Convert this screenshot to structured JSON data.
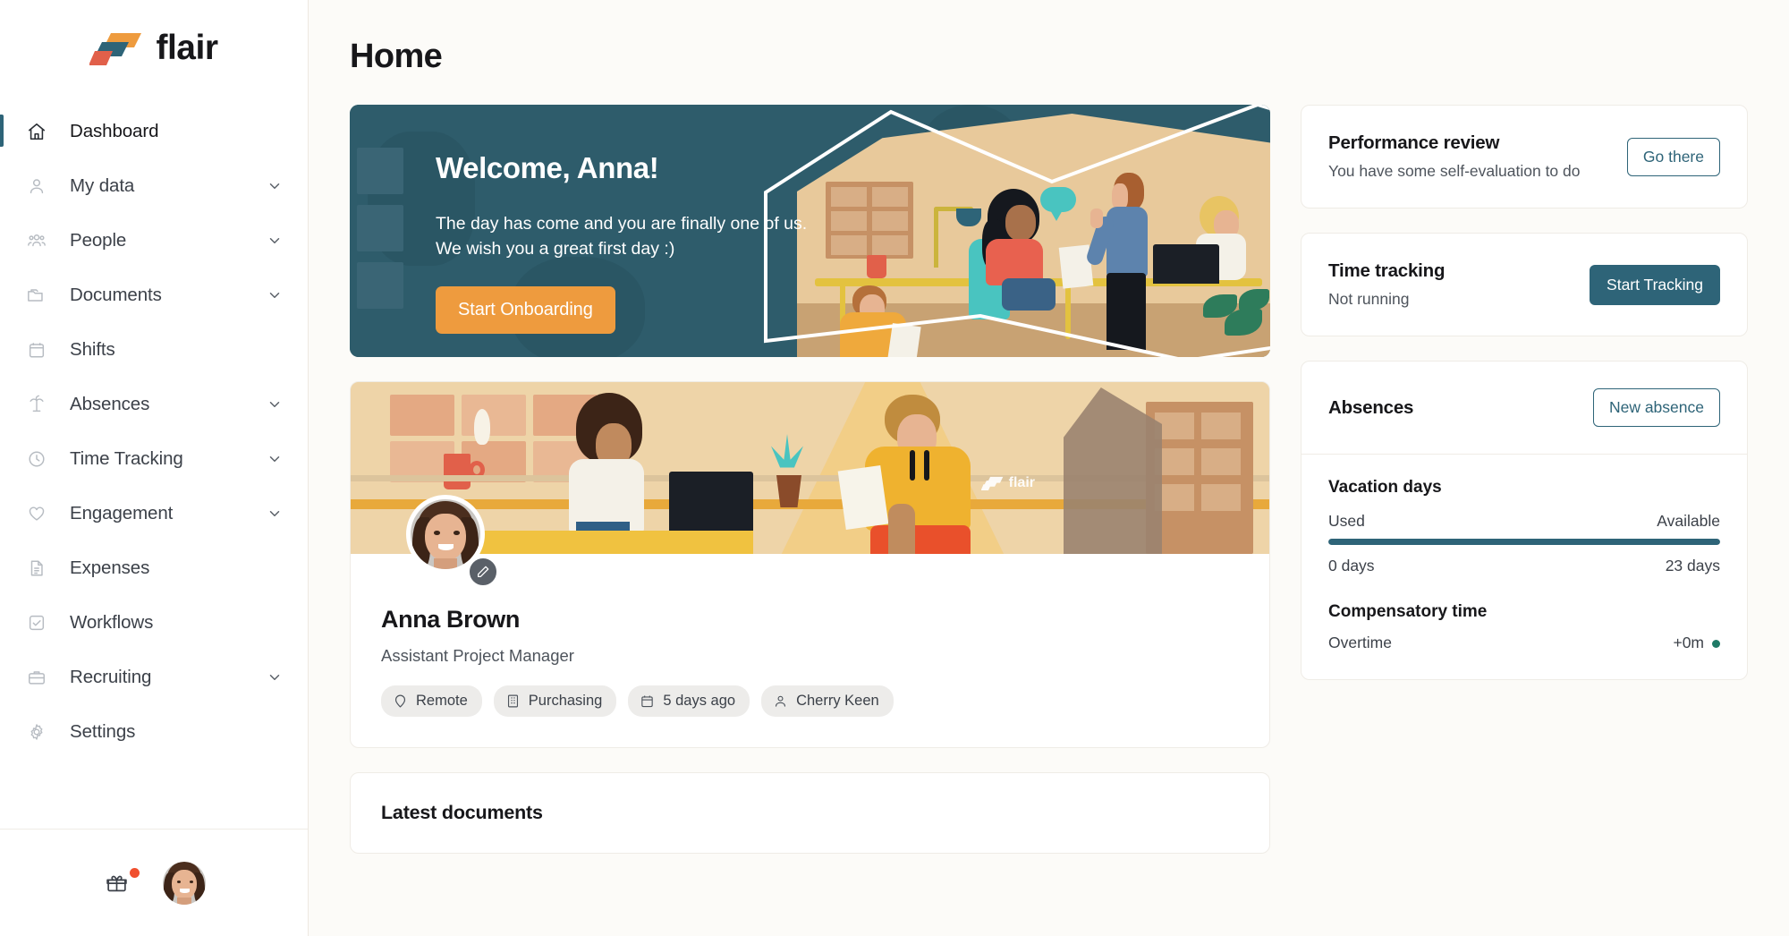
{
  "brand": {
    "name": "flair",
    "colors": {
      "orange": "#EE9B3E",
      "teal": "#2E6478",
      "coral": "#E1604A",
      "dark": "#17171A"
    }
  },
  "sidebar": {
    "items": [
      {
        "label": "Dashboard",
        "icon": "home-icon",
        "active": true,
        "expandable": false
      },
      {
        "label": "My data",
        "icon": "user-icon",
        "active": false,
        "expandable": true
      },
      {
        "label": "People",
        "icon": "people-icon",
        "active": false,
        "expandable": true
      },
      {
        "label": "Documents",
        "icon": "folder-icon",
        "active": false,
        "expandable": true
      },
      {
        "label": "Shifts",
        "icon": "calendar-icon",
        "active": false,
        "expandable": false
      },
      {
        "label": "Absences",
        "icon": "palm-tree-icon",
        "active": false,
        "expandable": true
      },
      {
        "label": "Time Tracking",
        "icon": "clock-icon",
        "active": false,
        "expandable": true
      },
      {
        "label": "Engagement",
        "icon": "heart-icon",
        "active": false,
        "expandable": true
      },
      {
        "label": "Expenses",
        "icon": "document-icon",
        "active": false,
        "expandable": false
      },
      {
        "label": "Workflows",
        "icon": "checkbox-icon",
        "active": false,
        "expandable": false
      },
      {
        "label": "Recruiting",
        "icon": "briefcase-icon",
        "active": false,
        "expandable": true
      },
      {
        "label": "Settings",
        "icon": "gear-icon",
        "active": false,
        "expandable": false
      }
    ],
    "footer": {
      "gift_icon": "gift-icon",
      "has_notification": true,
      "avatar_icon": "user-avatar"
    }
  },
  "header": {
    "title": "Home"
  },
  "welcome": {
    "title": "Welcome, Anna!",
    "line1": "The day has come and you are finally one of us.",
    "line2": "We wish you a great first day :)",
    "cta": "Start Onboarding"
  },
  "profile": {
    "name": "Anna Brown",
    "role": "Assistant Project Manager",
    "edit_icon": "pencil-icon",
    "tags": [
      {
        "label": "Remote",
        "icon": "location-pin-icon"
      },
      {
        "label": "Purchasing",
        "icon": "building-icon"
      },
      {
        "label": "5 days ago",
        "icon": "calendar-icon"
      },
      {
        "label": "Cherry Keen",
        "icon": "person-icon"
      }
    ]
  },
  "documents": {
    "title": "Latest documents"
  },
  "cards": {
    "performance": {
      "title": "Performance review",
      "subtitle": "You have some self-evaluation to do",
      "button": "Go there"
    },
    "time_tracking": {
      "title": "Time tracking",
      "subtitle": "Not running",
      "button": "Start Tracking"
    },
    "absences": {
      "title": "Absences",
      "button": "New absence",
      "vacation_heading": "Vacation days",
      "used_label": "Used",
      "available_label": "Available",
      "used_value": "0 days",
      "available_value": "23 days",
      "progress_percent": 100,
      "comp_heading": "Compensatory time",
      "overtime_label": "Overtime",
      "overtime_value": "+0m"
    }
  }
}
